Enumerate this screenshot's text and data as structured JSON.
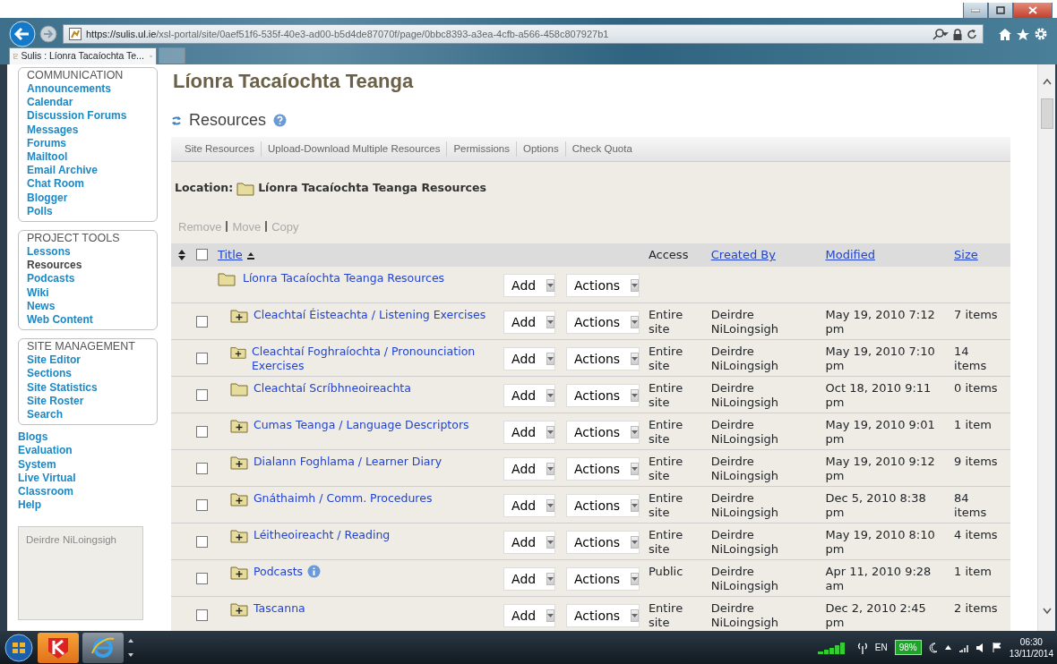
{
  "browser": {
    "url_host": "https://sulis.ul.ie",
    "url_path": "/xsl-portal/site/0aef51f6-535f-40e3-ad00-b5d4de87070f/page/0bbc8393-a3ea-4cfb-a566-458c807927b1",
    "tab_title": "Sulis : Líonra Tacaíochta Te..."
  },
  "sidebar": {
    "groups": [
      {
        "title": "COMMUNICATION",
        "items": [
          {
            "label": "Announcements",
            "selected": false
          },
          {
            "label": "Calendar",
            "selected": false
          },
          {
            "label": "Discussion Forums",
            "selected": false
          },
          {
            "label": "Messages",
            "selected": false
          },
          {
            "label": "Forums",
            "selected": false
          },
          {
            "label": "Mailtool",
            "selected": false
          },
          {
            "label": "Email Archive",
            "selected": false
          },
          {
            "label": "Chat Room",
            "selected": false
          },
          {
            "label": "Blogger",
            "selected": false
          },
          {
            "label": "Polls",
            "selected": false
          }
        ]
      },
      {
        "title": "PROJECT TOOLS",
        "items": [
          {
            "label": "Lessons",
            "selected": false
          },
          {
            "label": "Resources",
            "selected": true
          },
          {
            "label": "Podcasts",
            "selected": false
          },
          {
            "label": "Wiki",
            "selected": false
          },
          {
            "label": "News",
            "selected": false
          },
          {
            "label": "Web Content",
            "selected": false
          }
        ]
      },
      {
        "title": "SITE MANAGEMENT",
        "items": [
          {
            "label": "Site Editor",
            "selected": false
          },
          {
            "label": "Sections",
            "selected": false
          },
          {
            "label": "Site Statistics",
            "selected": false
          },
          {
            "label": "Site Roster",
            "selected": false
          },
          {
            "label": "Search",
            "selected": false
          }
        ]
      }
    ],
    "links": [
      {
        "label": "Blogs",
        "selected": false
      },
      {
        "label": "Evaluation",
        "selected": false
      },
      {
        "label": "System",
        "selected": false
      },
      {
        "label": "Live Virtual Classroom",
        "selected": false
      },
      {
        "label": "Help",
        "selected": false
      }
    ],
    "user": "Deirdre NiLoingsigh"
  },
  "page_title": "Líonra Tacaíochta Teanga",
  "tool_title": "Resources",
  "tool_menu": [
    "Site Resources",
    "Upload-Download Multiple Resources",
    "Permissions",
    "Options",
    "Check Quota"
  ],
  "location": {
    "label": "Location:",
    "path": "Líonra Tacaíochta Teanga Resources"
  },
  "item_actions": [
    {
      "label": "Remove",
      "disabled": true
    },
    {
      "label": "Move",
      "disabled": true
    },
    {
      "label": "Copy",
      "disabled": true
    }
  ],
  "table": {
    "select_all": {
      "checked": false
    },
    "columns": [
      {
        "label": "Title",
        "link": true
      },
      {
        "label": "Access",
        "link": false
      },
      {
        "label": "Created By",
        "link": true
      },
      {
        "label": "Modified",
        "link": true
      },
      {
        "label": "Size",
        "link": true
      }
    ],
    "root": {
      "title": "Líonra Tacaíochta Teanga Resources",
      "add": "Add",
      "actions": "Actions"
    },
    "rows": [
      {
        "title": "Cleachtaí Éisteachta / Listening Exercises",
        "expandable": true,
        "info": false,
        "checked": false,
        "add": "Add",
        "actions": "Actions",
        "access": "Entire site",
        "created_by": "Deirdre NiLoingsigh",
        "modified": "May 19, 2010 7:12 pm",
        "size": "7 items"
      },
      {
        "title": "Cleachtaí Foghraíochta / Pronounciation Exercises",
        "expandable": true,
        "info": false,
        "checked": false,
        "add": "Add",
        "actions": "Actions",
        "access": "Entire site",
        "created_by": "Deirdre NiLoingsigh",
        "modified": "May 19, 2010 7:10 pm",
        "size": "14 items"
      },
      {
        "title": "Cleachtaí Scríbhneoireachta",
        "expandable": false,
        "info": false,
        "checked": false,
        "add": "Add",
        "actions": "Actions",
        "access": "Entire site",
        "created_by": "Deirdre NiLoingsigh",
        "modified": "Oct 18, 2010 9:11 pm",
        "size": "0 items"
      },
      {
        "title": "Cumas Teanga / Language Descriptors",
        "expandable": true,
        "info": false,
        "checked": false,
        "add": "Add",
        "actions": "Actions",
        "access": "Entire site",
        "created_by": "Deirdre NiLoingsigh",
        "modified": "May 19, 2010 9:01 pm",
        "size": "1 item"
      },
      {
        "title": "Dialann Foghlama / Learner Diary",
        "expandable": true,
        "info": false,
        "checked": false,
        "add": "Add",
        "actions": "Actions",
        "access": "Entire site",
        "created_by": "Deirdre NiLoingsigh",
        "modified": "May 19, 2010 9:12 pm",
        "size": "9 items"
      },
      {
        "title": "Gnáthaimh / Comm. Procedures",
        "expandable": true,
        "info": false,
        "checked": false,
        "add": "Add",
        "actions": "Actions",
        "access": "Entire site",
        "created_by": "Deirdre NiLoingsigh",
        "modified": "Dec 5, 2010 8:38 pm",
        "size": "84 items"
      },
      {
        "title": "Léitheoireacht / Reading",
        "expandable": true,
        "info": false,
        "checked": false,
        "add": "Add",
        "actions": "Actions",
        "access": "Entire site",
        "created_by": "Deirdre NiLoingsigh",
        "modified": "May 19, 2010 8:10 pm",
        "size": "4 items"
      },
      {
        "title": "Podcasts",
        "expandable": true,
        "info": true,
        "checked": false,
        "add": "Add",
        "actions": "Actions",
        "access": "Public",
        "created_by": "Deirdre NiLoingsigh",
        "modified": "Apr 11, 2010 9:28 am",
        "size": "1 item"
      },
      {
        "title": "Tascanna",
        "expandable": true,
        "info": false,
        "checked": false,
        "add": "Add",
        "actions": "Actions",
        "access": "Entire site",
        "created_by": "Deirdre NiLoingsigh",
        "modified": "Dec 2, 2010 2:45 pm",
        "size": "2 items"
      }
    ]
  },
  "taskbar": {
    "language": "EN",
    "battery": "98%",
    "time": "06:30",
    "date": "13/11/2014"
  }
}
